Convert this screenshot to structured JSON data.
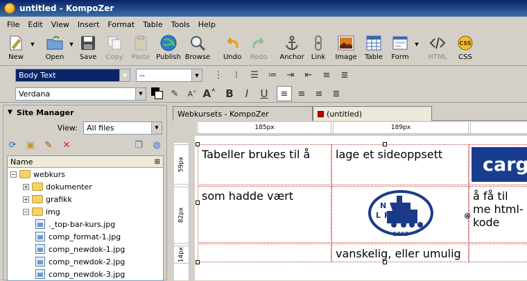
{
  "window": {
    "title": "untitled - KompoZer"
  },
  "menu": [
    "File",
    "Edit",
    "View",
    "Insert",
    "Format",
    "Table",
    "Tools",
    "Help"
  ],
  "toolbar": {
    "new": "New",
    "open": "Open",
    "save": "Save",
    "copy": "Copy",
    "paste": "Paste",
    "publish": "Publish",
    "browse": "Browse",
    "undo": "Undo",
    "redo": "Redo",
    "anchor": "Anchor",
    "link": "Link",
    "image": "Image",
    "table": "Table",
    "form": "Form",
    "html": "HTML",
    "css": "CSS"
  },
  "format": {
    "paragraph_style": "Body Text",
    "class_value": "--",
    "font": "Verdana"
  },
  "site_manager": {
    "title": "Site Manager",
    "view_label": "View:",
    "view_value": "All files",
    "column_header": "Name",
    "tree": [
      {
        "label": "webkurs",
        "type": "folder",
        "expanded": true,
        "depth": 0
      },
      {
        "label": "dokumenter",
        "type": "folder",
        "expanded": false,
        "depth": 1
      },
      {
        "label": "grafikk",
        "type": "folder",
        "expanded": false,
        "depth": 1
      },
      {
        "label": "img",
        "type": "folder",
        "expanded": true,
        "depth": 1
      },
      {
        "label": "._top-bar-kurs.jpg",
        "type": "file",
        "depth": 2
      },
      {
        "label": "comp_format-1.jpg",
        "type": "file",
        "depth": 2
      },
      {
        "label": "comp_newdok-1.jpg",
        "type": "file",
        "depth": 2
      },
      {
        "label": "comp_newdok-2.jpg",
        "type": "file",
        "depth": 2
      },
      {
        "label": "comp_newdok-3.jpg",
        "type": "file",
        "depth": 2
      }
    ]
  },
  "tabs": [
    "Webkursets - KompoZer",
    "(untitled)"
  ],
  "rulers": {
    "columns": [
      "185px",
      "189px"
    ],
    "rows": [
      "59px",
      "82px",
      "14px"
    ]
  },
  "table_cells": {
    "r1c1": "Tabeller brukes til å",
    "r1c2": "lage et sideoppsett",
    "r1c3_image": "carg",
    "r2c1": "som hadde vært",
    "r2c3": "å få til me html-kode",
    "r3c2": "vanskelig, eller umulig"
  },
  "logo": {
    "letters": [
      "N",
      "L",
      "F"
    ],
    "year": "1893"
  },
  "colors": {
    "title_bar": "#0a246a",
    "selection": "#0a246a",
    "cargo_blue": "#1a3c8f",
    "logo_blue": "#1b3a8a"
  }
}
